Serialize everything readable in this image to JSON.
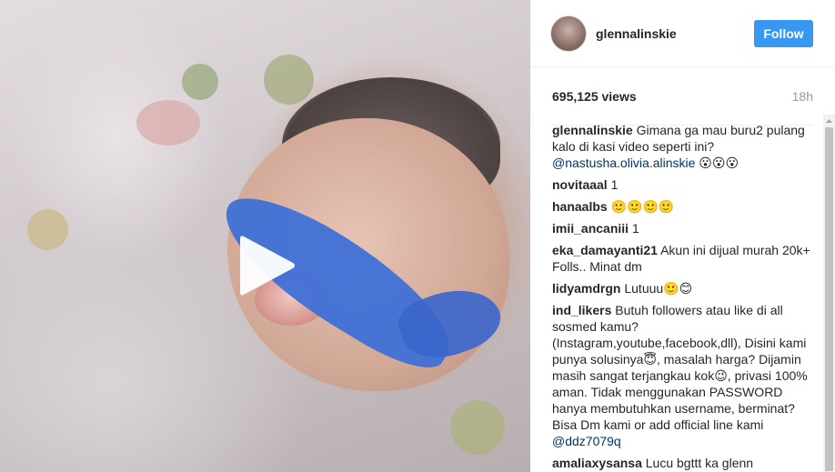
{
  "post": {
    "username": "glennalinskie",
    "follow_label": "Follow",
    "views": "695,125 views",
    "time_ago": "18h"
  },
  "media": {
    "play_icon": "play-icon",
    "play_color": "#ffffff"
  },
  "comments": [
    {
      "user": "glennalinskie",
      "text": "Gimana ga mau buru2 pulang kalo di kasi video seperti ini?",
      "mention": "@nastusha.olivia.alinskie",
      "suffix": " 😮😮😮"
    },
    {
      "user": "novitaaal",
      "text": "1"
    },
    {
      "user": "hanaalbs",
      "text": "🙂🙂🙂🙂"
    },
    {
      "user": "imii_ancaniii",
      "text": "1"
    },
    {
      "user": "eka_damayanti21",
      "text": "Akun ini dijual murah 20k+ Folls.. Minat dm"
    },
    {
      "user": "lidyamdrgn",
      "text": "Lutuuu🙂😊"
    },
    {
      "user": "ind_likers",
      "text": "Butuh followers atau like di all sosmed kamu? (Instagram,youtube,facebook,dll), Disini kami punya solusinya😇, masalah harga? Dijamin masih sangat terjangkau kok😉, privasi 100% aman. Tidak menggunakan PASSWORD hanya membutuhkan username, berminat? Bisa Dm kami or add official line kami",
      "mention": "@ddz7079q"
    },
    {
      "user": "amaliaxysansa",
      "text": "Lucu bgttt ka glenn"
    }
  ],
  "colors": {
    "accent": "#3897f0",
    "mention": "#003569"
  }
}
